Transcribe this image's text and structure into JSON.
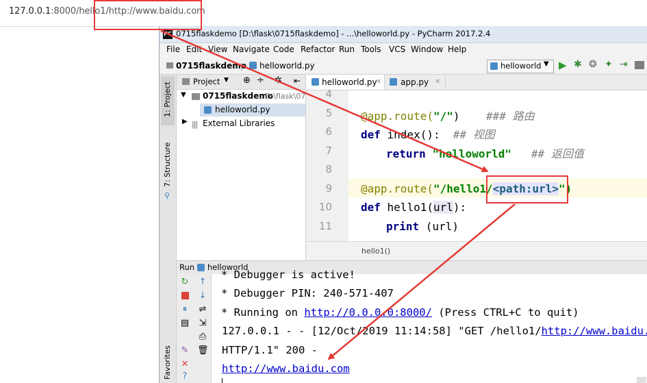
{
  "browser": {
    "url_host": "127.0.0.1",
    "url_rest": ":8000/hello1/http://www.baidu.com"
  },
  "window": {
    "logo": "PC",
    "title": "0715flaskdemo   [D:\\flask\\0715flaskdemo] - ...\\helloworld.py - PyCharm 2017.2.4"
  },
  "menu": [
    "File",
    "Edit",
    "View",
    "Navigate",
    "Code",
    "Refactor",
    "Run",
    "Tools",
    "VCS",
    "Window",
    "Help"
  ],
  "navbar": {
    "crumb_project": "0715flaskdemo",
    "crumb_file": "helloworld.py",
    "run_config": "helloworld"
  },
  "left_strip": {
    "project_label": "1: Project",
    "structure_label": "7: Structure",
    "favorites_label": "Favorites"
  },
  "project": {
    "header_label": "Project",
    "root_name": "0715flaskdemo",
    "root_path": "D:\\flask\\07",
    "file_name": "helloworld.py",
    "libraries_label": "External Libraries"
  },
  "editor": {
    "tabs": [
      {
        "label": "helloworld.py",
        "active": true
      },
      {
        "label": "app.py",
        "active": false
      }
    ],
    "line_numbers": [
      "4",
      "5",
      "6",
      "7",
      "8",
      "9",
      "10",
      "11"
    ],
    "lines": {
      "l5_dec": "@app.route(",
      "l5_str": "\"/\"",
      "l5_close": ")",
      "l5_cmt": "### 路由",
      "l6_kw": "def",
      "l6_name": " index():",
      "l6_cmt": "## 视图",
      "l7_kw": "return",
      "l7_str": "\"helloworld\"",
      "l7_cmt": "## 返回值",
      "l9_dec": "@app.route(",
      "l9_str": "\"/hello1/",
      "l9_path": "<path:url>",
      "l9_end": "\")",
      "l10_kw": "def",
      "l10_name": " hello1(",
      "l10_param": "url",
      "l10_close": "):",
      "l11_kw": "print",
      "l11_arg": " (url)"
    },
    "breadcrumb": "hello1()"
  },
  "run": {
    "header_label": "Run",
    "config_label": "helloworld",
    "console": {
      "line1": " * Debugger is active!",
      "line2": " * Debugger PIN: 240-571-407",
      "line3_pre": " * Running on ",
      "line3_link": "http://0.0.0.0:8000/",
      "line3_post": " (Press CTRL+C to quit)",
      "line4_pre": "127.0.0.1 - - [12/Oct/2019 11:14:58] \"GET /hello1/",
      "line4_link": "http://www.baidu.c",
      "line5": " HTTP/1.1\" 200 -",
      "line6_link": "http://www.baidu.com"
    }
  },
  "colors": {
    "annotation_red": "#e53935",
    "keyword": "#000080",
    "string": "#008000",
    "link": "#0000cc"
  }
}
